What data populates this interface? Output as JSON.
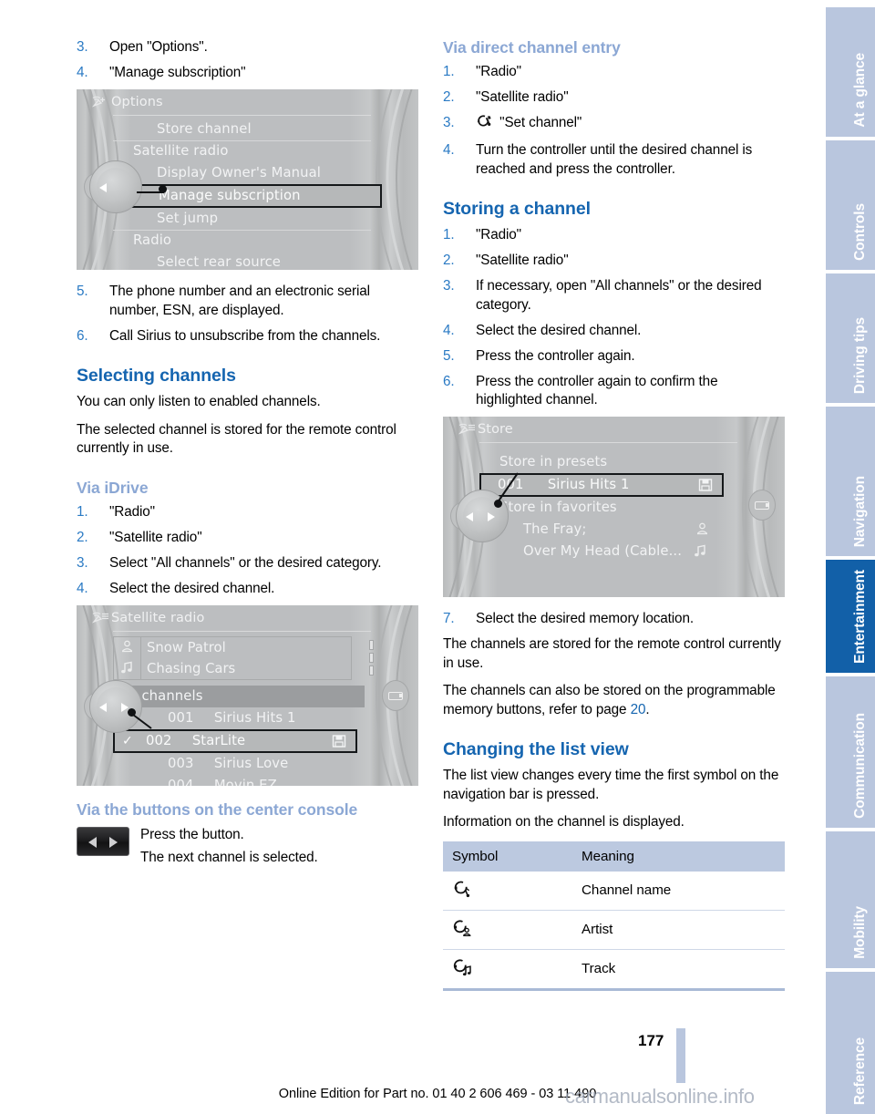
{
  "document": {
    "page_number": "177",
    "edition_line": "Online Edition for Part no. 01 40 2 606 469 - 03 11 490",
    "watermark": "carmanualsonline.info"
  },
  "left_column": {
    "steps_top": [
      {
        "num": "3.",
        "text": "Open \"Options\"."
      },
      {
        "num": "4.",
        "text": "\"Manage subscription\""
      }
    ],
    "figure_options": {
      "title": "Options",
      "title_icon": "satellite-antenna-plus-icon",
      "rows": [
        {
          "label": "Store channel",
          "indent": "indent2"
        },
        {
          "label": "Satellite radio",
          "indent": "indent1",
          "separator": true
        },
        {
          "label": "Display Owner's Manual",
          "indent": "indent2"
        },
        {
          "label": "Manage subscription",
          "indent": "indent2",
          "boxed": true
        },
        {
          "label": "Set jump",
          "indent": "indent2"
        },
        {
          "label": "Radio",
          "indent": "indent1",
          "separator": true
        },
        {
          "label": "Select rear source",
          "indent": "indent2"
        }
      ]
    },
    "steps_after_figure": [
      {
        "num": "5.",
        "text": "The phone number and an electronic serial number, ESN, are displayed."
      },
      {
        "num": "6.",
        "text": "Call Sirius to unsubscribe from the channels."
      }
    ],
    "heading_selecting_channels": "Selecting channels",
    "para_enabled": "You can only listen to enabled channels.",
    "para_stored_remote": "The selected channel is stored for the remote control currently in use.",
    "heading_via_idrive": "Via iDrive",
    "steps_via_idrive": [
      {
        "num": "1.",
        "text": "\"Radio\""
      },
      {
        "num": "2.",
        "text": "\"Satellite radio\""
      },
      {
        "num": "3.",
        "text": "Select \"All channels\" or the desired category."
      },
      {
        "num": "4.",
        "text": "Select the desired channel."
      }
    ],
    "figure_satellite_radio": {
      "title": "Satellite radio",
      "title_icon": "satellite-antenna-list-icon",
      "now_playing": [
        {
          "icon": "artist-icon",
          "label": "Snow Patrol"
        },
        {
          "icon": "music-note-icon",
          "label": "Chasing Cars"
        }
      ],
      "band_label": "All channels",
      "channels": [
        {
          "number": "001",
          "name": "Sirius Hits 1",
          "checked": false,
          "boxed": false,
          "icon": ""
        },
        {
          "number": "002",
          "name": "StarLite",
          "checked": true,
          "boxed": true,
          "icon": "preset-save-icon"
        },
        {
          "number": "003",
          "name": "Sirius Love",
          "checked": false,
          "boxed": false,
          "icon": ""
        },
        {
          "number": "004",
          "name": "Movin EZ",
          "checked": false,
          "boxed": false,
          "icon": ""
        }
      ]
    },
    "heading_center_console": "Via the buttons on the center console",
    "console_button_icon": "seek-prev-next-button",
    "console_lines": [
      "Press the button.",
      "The next channel is selected."
    ]
  },
  "right_column": {
    "heading_direct_entry": "Via direct channel entry",
    "steps_direct_entry": [
      {
        "num": "1.",
        "text": "\"Radio\"",
        "icon": ""
      },
      {
        "num": "2.",
        "text": "\"Satellite radio\"",
        "icon": ""
      },
      {
        "num": "3.",
        "text": "\"Set channel\"",
        "icon": "set-channel-icon"
      },
      {
        "num": "4.",
        "text": "Turn the controller until the desired channel is reached and press the controller.",
        "icon": ""
      }
    ],
    "heading_storing": "Storing a channel",
    "steps_storing": [
      {
        "num": "1.",
        "text": "\"Radio\""
      },
      {
        "num": "2.",
        "text": "\"Satellite radio\""
      },
      {
        "num": "3.",
        "text": "If necessary, open \"All channels\" or the desired category."
      },
      {
        "num": "4.",
        "text": "Select the desired channel."
      },
      {
        "num": "5.",
        "text": "Press the controller again."
      },
      {
        "num": "6.",
        "text": "Press the controller again to confirm the highlighted channel."
      }
    ],
    "figure_store": {
      "title": "Store",
      "title_icon": "satellite-antenna-list-icon",
      "rows": [
        {
          "label": "Store in presets",
          "kind": "group"
        },
        {
          "number": "001",
          "label": "Sirius Hits 1",
          "kind": "boxed",
          "icon": "preset-save-icon"
        },
        {
          "label": "Store in favorites",
          "kind": "group"
        },
        {
          "label": "The Fray;",
          "kind": "item",
          "icon": "artist-icon"
        },
        {
          "label": "Over My Head (Cable...",
          "kind": "item",
          "icon": "music-note-icon"
        }
      ]
    },
    "step_seven": {
      "num": "7.",
      "text": "Select the desired memory location."
    },
    "para_stored_remote": "The channels are stored for the remote control currently in use.",
    "para_memory_buttons_pre": "The channels can also be stored on the programmable memory buttons, refer to page ",
    "para_memory_buttons_ref": "20",
    "para_memory_buttons_post": ".",
    "heading_list_view": "Changing the list view",
    "para_list_view": "The list view changes every time the first symbol on the navigation bar is pressed.",
    "para_information": "Information on the channel is displayed.",
    "table": {
      "headers": [
        "Symbol",
        "Meaning"
      ],
      "rows": [
        {
          "symbol": "channel-name-icon",
          "meaning": "Channel name"
        },
        {
          "symbol": "artist-icon",
          "meaning": "Artist"
        },
        {
          "symbol": "track-icon",
          "meaning": "Track"
        }
      ]
    }
  },
  "sidebar": {
    "tabs": [
      {
        "label": "At a glance",
        "active": false
      },
      {
        "label": "Controls",
        "active": false
      },
      {
        "label": "Driving tips",
        "active": false
      },
      {
        "label": "Navigation",
        "active": false
      },
      {
        "label": "Entertainment",
        "active": true
      },
      {
        "label": "Communication",
        "active": false
      },
      {
        "label": "Mobility",
        "active": false
      },
      {
        "label": "Reference",
        "active": false
      }
    ],
    "colors": {
      "inactive": "#b9c6de",
      "active": "#1260a8"
    }
  },
  "colors": {
    "heading_blue": "#1565b0",
    "subheading_blue": "#8ba7d4",
    "step_number_blue": "#2a7ac4",
    "table_header": "#bcc9e0"
  }
}
